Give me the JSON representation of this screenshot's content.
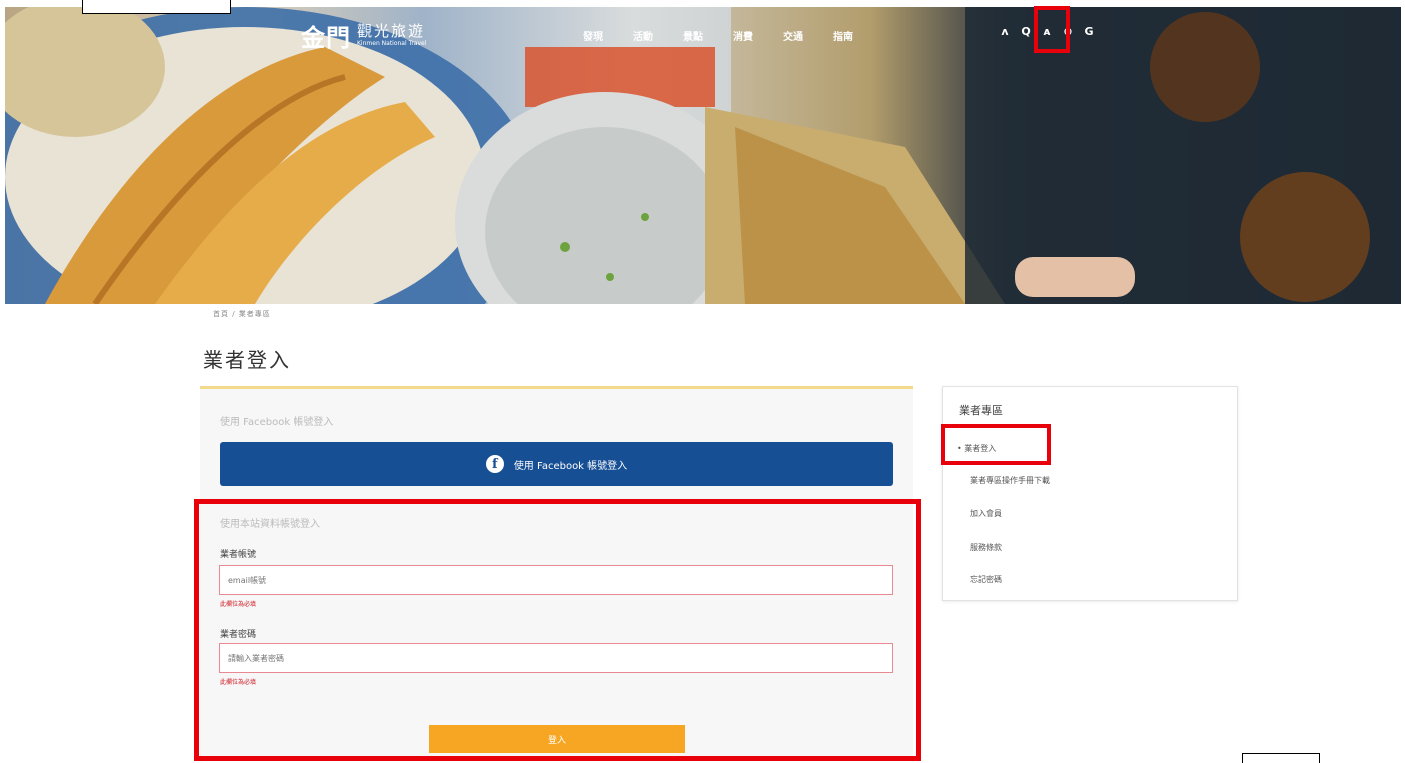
{
  "header": {
    "logo_main": "金門",
    "logo_sub": "觀光旅遊",
    "logo_en": "Kinmen National Travel",
    "menu": [
      "發現",
      "活動",
      "景點",
      "消費",
      "交通",
      "指南"
    ],
    "tools": [
      "ʌ",
      "Q",
      "ᴀ",
      "⊕",
      "G"
    ]
  },
  "breadcrumb": "首頁 / 業者專區",
  "page_title": "業者登入",
  "login": {
    "facebook_heading": "使用 Facebook 帳號登入",
    "facebook_button": "使用 Facebook 帳號登入",
    "facebook_icon": "f",
    "local_heading": "使用本站資料帳號登入",
    "account_label": "業者帳號",
    "account_placeholder": "email帳號",
    "account_error": "此欄位為必填",
    "password_label": "業者密碼",
    "password_placeholder": "請輸入業者密碼",
    "password_error": "此欄位為必填",
    "submit": "登入"
  },
  "sidebar": {
    "title": "業者專區",
    "items": [
      {
        "label": "業者登入",
        "active": true
      },
      {
        "label": "業者專區操作手冊下載",
        "active": false
      },
      {
        "label": "加入會員",
        "active": false
      },
      {
        "label": "服務條款",
        "active": false
      },
      {
        "label": "忘記密碼",
        "active": false
      }
    ]
  },
  "colors": {
    "facebook": "#174f95",
    "accent": "#f6a623",
    "highlight": "#e8000b",
    "error": "#d0161f"
  }
}
